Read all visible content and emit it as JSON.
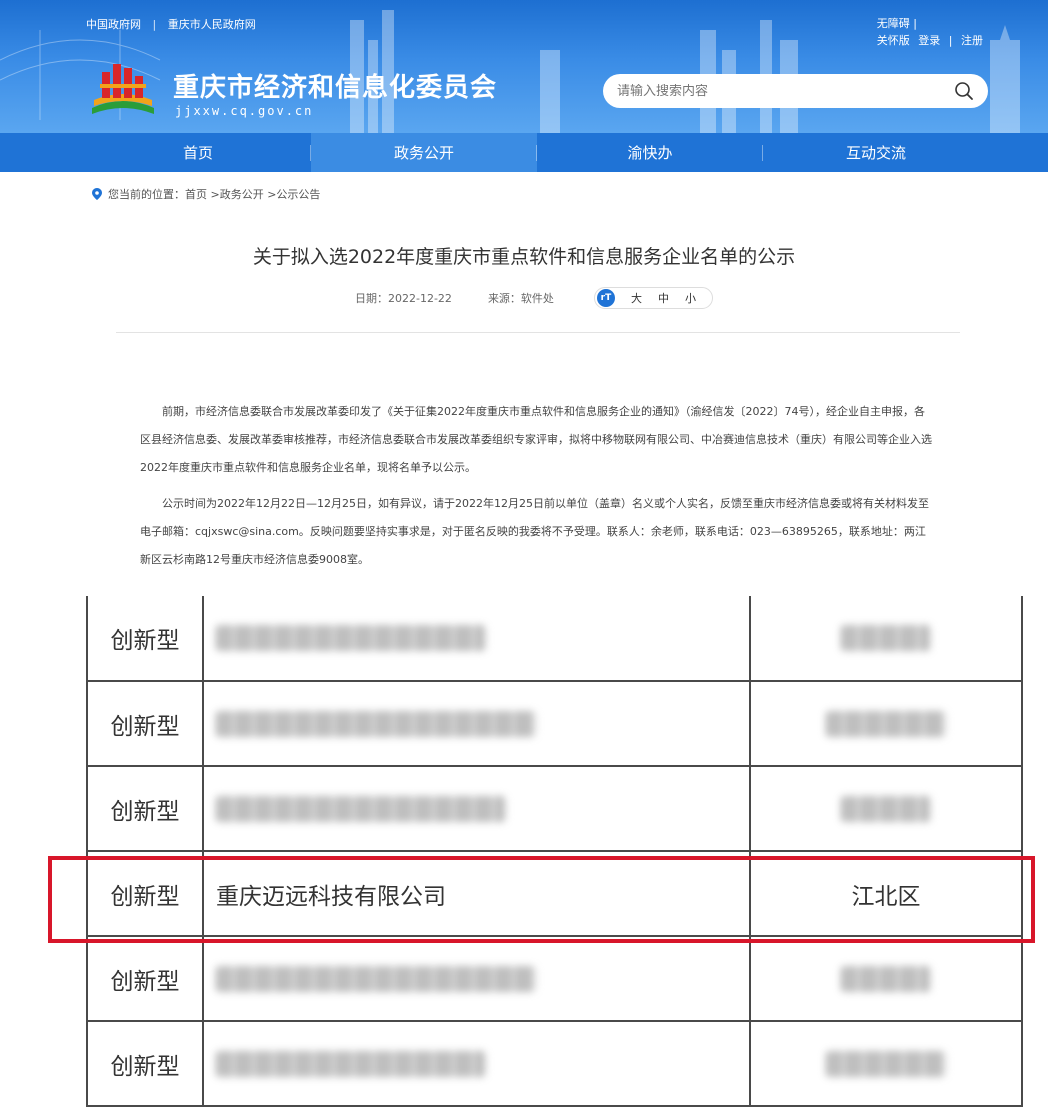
{
  "header": {
    "top_links": [
      "中国政府网",
      "重庆市人民政府网"
    ],
    "top_right": {
      "accessibility": "无障碍",
      "elder_mode": "关怀版",
      "login": "登录",
      "register": "注册"
    },
    "site_title": "重庆市经济和信息化委员会",
    "site_domain": "jjxxw.cq.gov.cn",
    "search_placeholder": "请输入搜索内容"
  },
  "nav": {
    "items": [
      "首页",
      "政务公开",
      "渝快办",
      "互动交流"
    ],
    "active": "政务公开"
  },
  "breadcrumb": {
    "text": "您当前的位置：首页 >政务公开 >公示公告"
  },
  "article": {
    "title": "关于拟入选2022年度重庆市重点软件和信息服务企业名单的公示",
    "date": "日期：2022-12-22",
    "source": "来源：软件处",
    "font_sizes": [
      "大",
      "中",
      "小"
    ],
    "paragraphs": [
      "前期，市经济信息委联合市发展改革委印发了《关于征集2022年度重庆市重点软件和信息服务企业的通知》（渝经信发〔2022〕74号），经企业自主申报，各区县经济信息委、发展改革委审核推荐，市经济信息委联合市发展改革委组织专家评审，拟将中移物联网有限公司、中冶赛迪信息技术（重庆）有限公司等企业入选2022年度重庆市重点软件和信息服务企业名单，现将名单予以公示。",
      "公示时间为2022年12月22日—12月25日，如有异议，请于2022年12月25日前以单位（盖章）名义或个人实名，反馈至重庆市经济信息委或将有关材料发至电子邮箱：cqjxswc@sina.com。反映问题要坚持实事求是，对于匿名反映的我委将不予受理。联系人：余老师，联系电话：023—63895265，联系地址：两江新区云杉南路12号重庆市经济信息委9008室。"
    ]
  },
  "table": {
    "rows": [
      {
        "type": "创新型",
        "company": "",
        "district": "",
        "blurred": true
      },
      {
        "type": "创新型",
        "company": "",
        "district": "",
        "blurred": true
      },
      {
        "type": "创新型",
        "company": "",
        "district": "",
        "blurred": true
      },
      {
        "type": "创新型",
        "company": "重庆迈远科技有限公司",
        "district": "江北区",
        "blurred": false,
        "highlighted": true
      },
      {
        "type": "创新型",
        "company": "",
        "district": "",
        "blurred": true
      },
      {
        "type": "创新型",
        "company": "",
        "district": "",
        "blurred": true
      }
    ]
  },
  "colors": {
    "header_blue": "#1d6fd1",
    "nav_blue": "#1f73d6",
    "nav_active": "#3b8ce3",
    "highlight_red": "#d8162a"
  }
}
